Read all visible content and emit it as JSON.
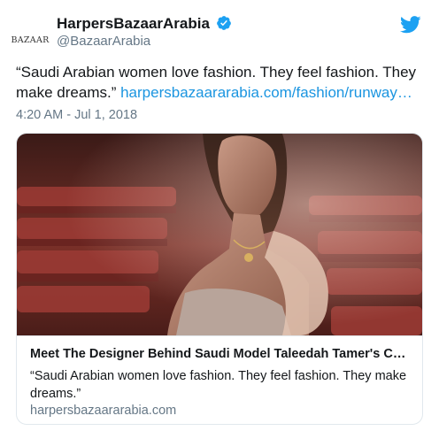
{
  "author": {
    "avatar_text": "BAZAAR",
    "display_name": "HarpersBazaarArabia",
    "handle": "@BazaarArabia",
    "verified": true
  },
  "tweet": {
    "text": "“Saudi Arabian women love fashion. They feel fashion. They make dreams.” ",
    "link_text": "harpersbazaararabia.com/fashion/runway…",
    "timestamp": "4:20 AM - Jul 1, 2018"
  },
  "card": {
    "title": "Meet The Designer Behind Saudi Model Taleedah Tamer's Cou...",
    "description": "“Saudi Arabian women love fashion. They feel fashion. They make dreams.”",
    "domain": "harpersbazaararabia.com"
  },
  "icons": {
    "verified": "verified-badge-icon",
    "platform": "twitter-bird-icon"
  },
  "colors": {
    "link": "#1b95e0",
    "verified": "#1da1f2",
    "muted": "#657786",
    "text": "#14171a",
    "border": "#e1e8ed"
  }
}
